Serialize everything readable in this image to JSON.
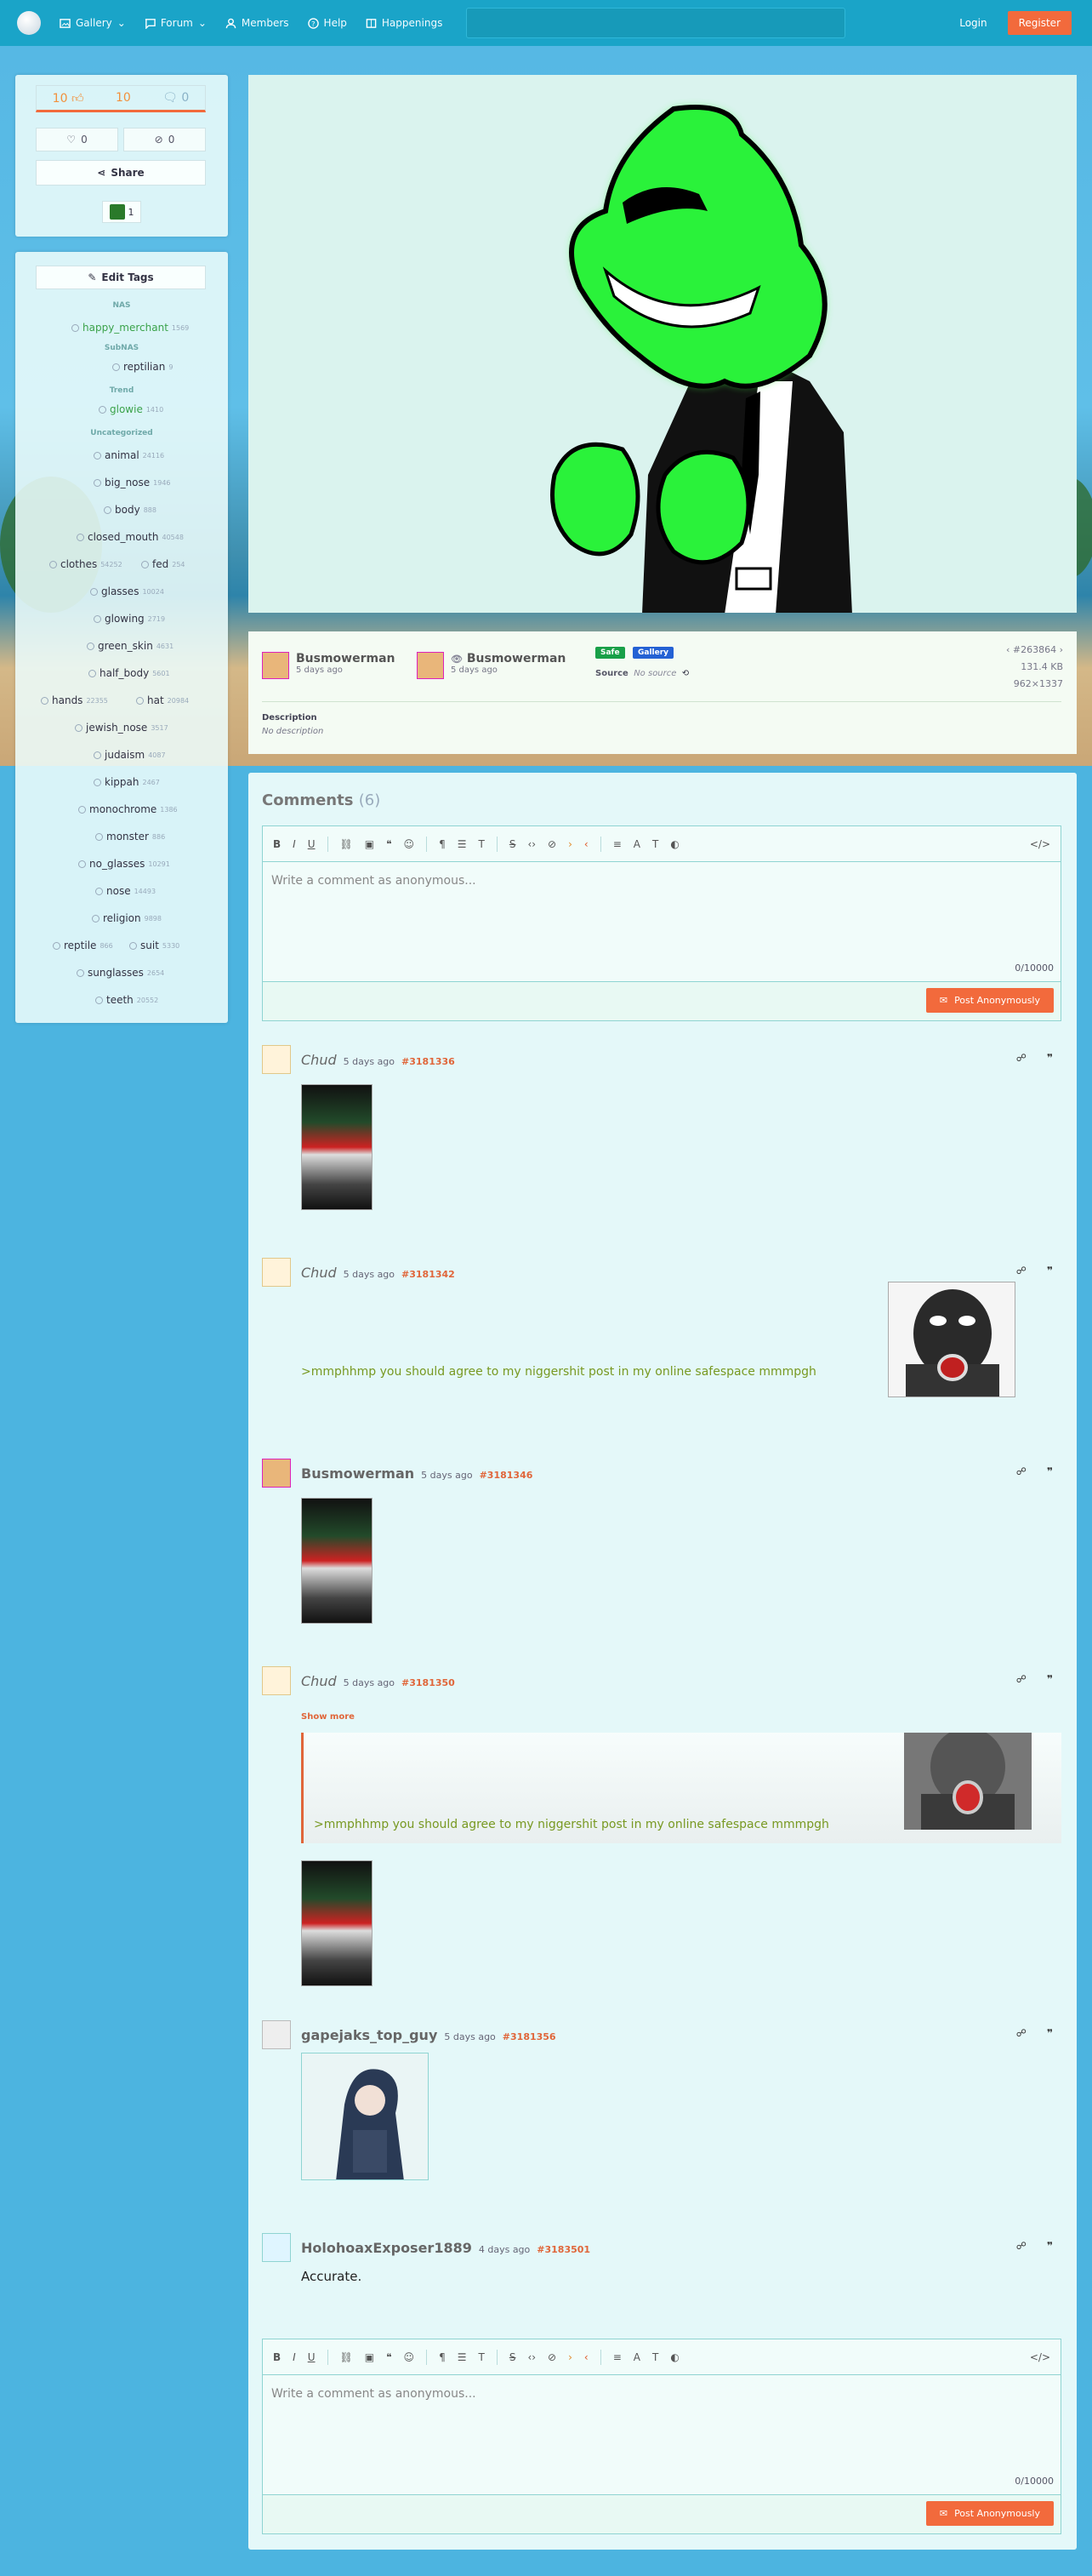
{
  "nav": {
    "gallery": "Gallery",
    "forum": "Forum",
    "members": "Members",
    "help": "Help",
    "happenings": "Happenings",
    "login": "Login",
    "register": "Register"
  },
  "score": {
    "up": "10",
    "total": "10",
    "comments": "0"
  },
  "fav": {
    "faves": "0",
    "hides": "0",
    "share": "Share"
  },
  "awards": {
    "count": "1"
  },
  "tags": {
    "edit_label": "Edit Tags",
    "categories": [
      "NAS",
      "SubNAS",
      "Trend",
      "Uncategorized"
    ],
    "list": [
      {
        "name": "happy_merchant",
        "count": "1569"
      },
      {
        "name": "reptilian",
        "count": "9"
      },
      {
        "name": "glowie",
        "count": "1410"
      },
      {
        "name": "animal",
        "count": "24116"
      },
      {
        "name": "big_nose",
        "count": "1946"
      },
      {
        "name": "body",
        "count": "888"
      },
      {
        "name": "closed_mouth",
        "count": "40548"
      },
      {
        "name": "clothes",
        "count": "54252"
      },
      {
        "name": "fed",
        "count": "254"
      },
      {
        "name": "glasses",
        "count": "10024"
      },
      {
        "name": "glowing",
        "count": "2719"
      },
      {
        "name": "green_skin",
        "count": "4631"
      },
      {
        "name": "half_body",
        "count": "5601"
      },
      {
        "name": "hands",
        "count": "22355"
      },
      {
        "name": "hat",
        "count": "20984"
      },
      {
        "name": "jewish_nose",
        "count": "3517"
      },
      {
        "name": "judaism",
        "count": "4087"
      },
      {
        "name": "kippah",
        "count": "2467"
      },
      {
        "name": "monochrome",
        "count": "1386"
      },
      {
        "name": "monster",
        "count": "886"
      },
      {
        "name": "no_glasses",
        "count": "10291"
      },
      {
        "name": "nose",
        "count": "14493"
      },
      {
        "name": "religion",
        "count": "9898"
      },
      {
        "name": "reptile",
        "count": "866"
      },
      {
        "name": "suit",
        "count": "5330"
      },
      {
        "name": "sunglasses",
        "count": "2654"
      },
      {
        "name": "teeth",
        "count": "20552"
      }
    ]
  },
  "meta": {
    "uploader": "Busmowerman",
    "uploader_time": "5 days ago",
    "editor": "Busmowerman",
    "editor_time": "5 days ago",
    "rating": "Safe",
    "category": "Gallery",
    "source_label": "Source",
    "source_value": "No source",
    "post_id": "#263864",
    "size": "131.4 KB",
    "dims": "962×1337",
    "desc_label": "Description",
    "desc_value": "No description"
  },
  "comments_section": {
    "title": "Comments",
    "count": "(6)",
    "placeholder": "Write a comment as anonymous...",
    "counter": "0/10000",
    "post_button": "Post Anonymously",
    "show_more": "Show more"
  },
  "comments": [
    {
      "author": "Chud",
      "time": "5 days ago",
      "id": "#3181336"
    },
    {
      "author": "Chud",
      "time": "5 days ago",
      "id": "#3181342",
      "text": ">mmphhmp you should agree to my niggershit post in my online safespace mmmpgh"
    },
    {
      "author": "Busmowerman",
      "time": "5 days ago",
      "id": "#3181346"
    },
    {
      "author": "Chud",
      "time": "5 days ago",
      "id": "#3181350",
      "text": ">mmphhmp you should agree to my niggershit post in my online safespace mmmpgh"
    },
    {
      "author": "gapejaks_top_guy",
      "time": "5 days ago",
      "id": "#3181356"
    },
    {
      "author": "HolohoaxExposer1889",
      "time": "4 days ago",
      "id": "#3183501",
      "text": "Accurate."
    }
  ]
}
